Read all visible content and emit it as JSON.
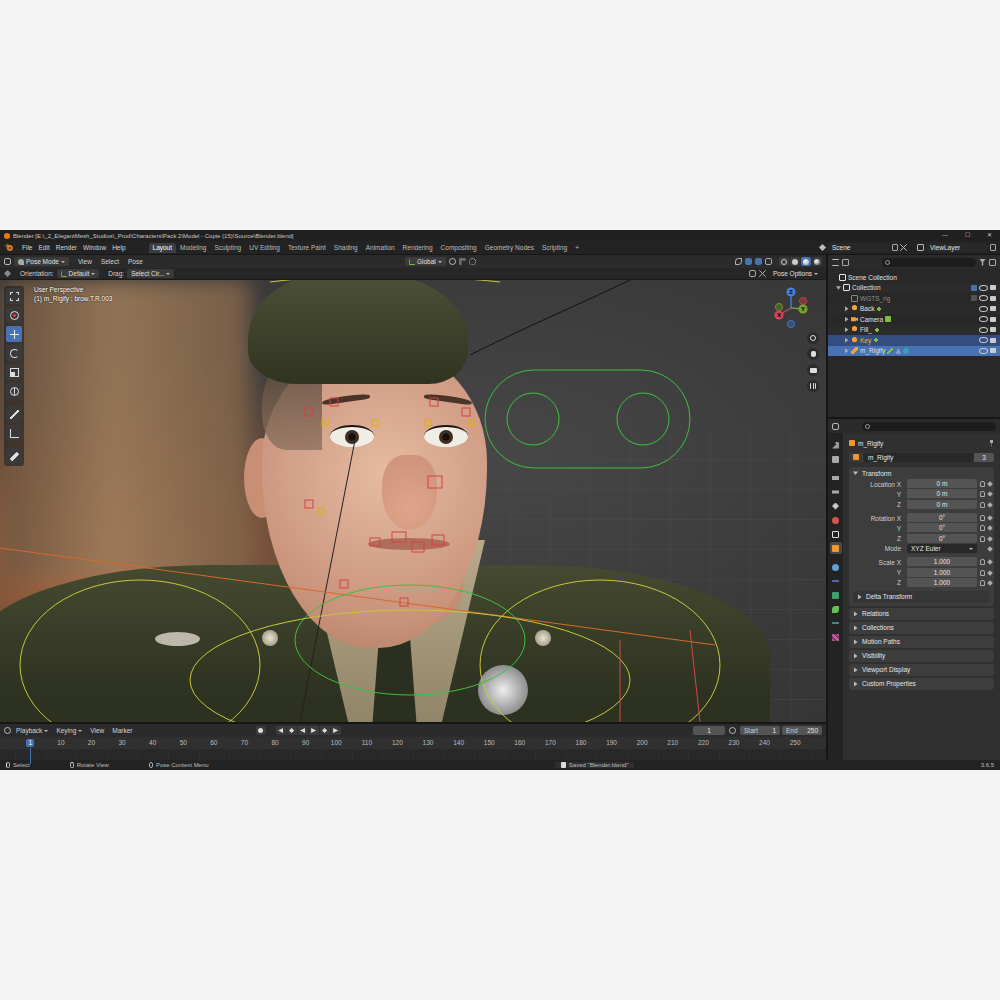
{
  "window": {
    "title": "Blender [E:\\_2_ElegantMesh_Studios\\_Prod\\Characters\\Pack 2\\Model - Copie (15)\\Source\\Blender.blend]",
    "controls": [
      "—",
      "☐",
      "✕"
    ]
  },
  "menu": [
    "File",
    "Edit",
    "Render",
    "Window",
    "Help"
  ],
  "workspaces": [
    {
      "label": "Layout",
      "selected": true
    },
    {
      "label": "Modeling",
      "selected": false
    },
    {
      "label": "Sculpting",
      "selected": false
    },
    {
      "label": "UV Editing",
      "selected": false
    },
    {
      "label": "Texture Paint",
      "selected": false
    },
    {
      "label": "Shading",
      "selected": false
    },
    {
      "label": "Animation",
      "selected": false
    },
    {
      "label": "Rendering",
      "selected": false
    },
    {
      "label": "Compositing",
      "selected": false
    },
    {
      "label": "Geometry Nodes",
      "selected": false
    },
    {
      "label": "Scripting",
      "selected": false
    }
  ],
  "add_workspace": "+",
  "scene": "Scene",
  "view_layer": "ViewLayer",
  "viewport": {
    "mode": "Pose Mode",
    "menus": [
      "View",
      "Select",
      "Pose"
    ],
    "transform_orientation": "Global",
    "orientation_label": "Orientation:",
    "orientation": "Default",
    "drag_label": "Drag:",
    "drag": "Select Cir...",
    "pose_options": "Pose Options",
    "perspective": "User Perspective",
    "active_bone": "(1) m_Rigify : brow.T.R.003",
    "axes": [
      {
        "label": "X",
        "color": "#d8414f"
      },
      {
        "label": "Y",
        "color": "#74a32c"
      },
      {
        "label": "Z",
        "color": "#3f7fdc"
      }
    ],
    "tools": [
      {
        "kind": "select",
        "selected": false
      },
      {
        "kind": "cursor",
        "selected": false
      },
      {
        "kind": "move",
        "selected": true
      },
      {
        "kind": "rotate",
        "selected": false
      },
      {
        "kind": "scale",
        "selected": false
      },
      {
        "kind": "transform",
        "selected": false
      },
      {
        "kind": "annotate",
        "selected": false
      },
      {
        "kind": "measure",
        "selected": false
      },
      {
        "kind": "bone",
        "selected": false
      }
    ],
    "shading": [
      {
        "kind": "wireframe",
        "selected": false
      },
      {
        "kind": "solid",
        "selected": false
      },
      {
        "kind": "material",
        "selected": true
      },
      {
        "kind": "rendered",
        "selected": false
      }
    ]
  },
  "outliner": {
    "items": [
      {
        "label": "Scene Collection",
        "kind": "scene-collection",
        "level": 0,
        "expandable": false,
        "expanded": true,
        "selected": false,
        "active": false,
        "disabled": false
      },
      {
        "label": "Collection",
        "kind": "collection",
        "level": 1,
        "expandable": true,
        "expanded": true,
        "selected": false,
        "active": false,
        "disabled": false,
        "checked": true
      },
      {
        "label": "WGTS_rig",
        "kind": "collection",
        "level": 2,
        "expandable": false,
        "expanded": false,
        "selected": false,
        "active": false,
        "disabled": true,
        "checked": false
      },
      {
        "label": "Back",
        "kind": "light",
        "level": 2,
        "expandable": true,
        "expanded": false,
        "selected": false,
        "active": false,
        "disabled": false
      },
      {
        "label": "Camera",
        "kind": "camera",
        "level": 2,
        "expandable": true,
        "expanded": false,
        "selected": false,
        "active": false,
        "disabled": false
      },
      {
        "label": "Fill_",
        "kind": "light",
        "level": 2,
        "expandable": true,
        "expanded": false,
        "selected": false,
        "active": false,
        "disabled": false
      },
      {
        "label": "Key",
        "kind": "light",
        "level": 2,
        "expandable": true,
        "expanded": false,
        "selected": true,
        "active": false,
        "disabled": false
      },
      {
        "label": "m_Rigify",
        "kind": "armature",
        "level": 2,
        "expandable": true,
        "expanded": false,
        "selected": true,
        "active": true,
        "disabled": false
      }
    ]
  },
  "properties": {
    "tabs": [
      {
        "kind": "tool",
        "selected": false
      },
      {
        "kind": "render",
        "selected": false
      },
      {
        "kind": "output",
        "selected": false
      },
      {
        "kind": "view-layer",
        "selected": false
      },
      {
        "kind": "scene",
        "selected": false
      },
      {
        "kind": "world",
        "selected": false
      },
      {
        "kind": "collection",
        "selected": false
      },
      {
        "kind": "object",
        "selected": true
      },
      {
        "kind": "physics",
        "selected": false
      },
      {
        "kind": "object-constraints",
        "selected": false
      },
      {
        "kind": "object-data",
        "selected": false
      },
      {
        "kind": "bone",
        "selected": false
      },
      {
        "kind": "bone-constraints",
        "selected": false
      },
      {
        "kind": "texture",
        "selected": false
      }
    ],
    "object": "m_Rigify",
    "name": "m_Rigify",
    "users": "3",
    "transform_title": "Transform",
    "location": [
      {
        "label": "Location X",
        "value": "0 m"
      },
      {
        "label": "Y",
        "value": "0 m"
      },
      {
        "label": "Z",
        "value": "0 m"
      }
    ],
    "rotation": [
      {
        "label": "Rotation X",
        "value": "0°"
      },
      {
        "label": "Y",
        "value": "0°"
      },
      {
        "label": "Z",
        "value": "0°"
      }
    ],
    "mode_label": "Mode",
    "mode": "XYZ Euler",
    "scale": [
      {
        "label": "Scale X",
        "value": "1.000"
      },
      {
        "label": "Y",
        "value": "1.000"
      },
      {
        "label": "Z",
        "value": "1.000"
      }
    ],
    "panels": [
      "Delta Transform",
      "Relations",
      "Collections",
      "Motion Paths",
      "Visibility",
      "Viewport Display",
      "Custom Properties"
    ]
  },
  "timeline": {
    "menus": [
      "Playback",
      "Keying",
      "View",
      "Marker"
    ],
    "current_frame": "1",
    "start_label": "Start",
    "start": "1",
    "end_label": "End",
    "end": "250",
    "ticks": [
      {
        "label": "1",
        "selected": true
      },
      {
        "label": "10",
        "selected": false
      },
      {
        "label": "20",
        "selected": false
      },
      {
        "label": "30",
        "selected": false
      },
      {
        "label": "40",
        "selected": false
      },
      {
        "label": "50",
        "selected": false
      },
      {
        "label": "60",
        "selected": false
      },
      {
        "label": "70",
        "selected": false
      },
      {
        "label": "80",
        "selected": false
      },
      {
        "label": "90",
        "selected": false
      },
      {
        "label": "100",
        "selected": false
      },
      {
        "label": "110",
        "selected": false
      },
      {
        "label": "120",
        "selected": false
      },
      {
        "label": "130",
        "selected": false
      },
      {
        "label": "140",
        "selected": false
      },
      {
        "label": "150",
        "selected": false
      },
      {
        "label": "160",
        "selected": false
      },
      {
        "label": "170",
        "selected": false
      },
      {
        "label": "180",
        "selected": false
      },
      {
        "label": "190",
        "selected": false
      },
      {
        "label": "200",
        "selected": false
      },
      {
        "label": "210",
        "selected": false
      },
      {
        "label": "220",
        "selected": false
      },
      {
        "label": "230",
        "selected": false
      },
      {
        "label": "240",
        "selected": false
      },
      {
        "label": "250",
        "selected": false
      }
    ]
  },
  "status": {
    "hints": [
      "Select",
      "Rotate View",
      "Pose Context Menu"
    ],
    "message": "Saved \"Blender.blend\"",
    "version": "3.6.5"
  }
}
